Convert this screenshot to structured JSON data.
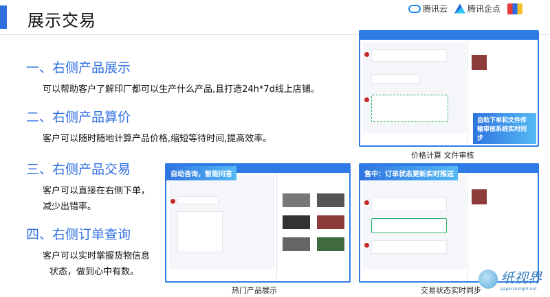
{
  "header": {
    "title": "展示交易",
    "logos": [
      "腾讯云",
      "腾讯企点"
    ]
  },
  "sections": [
    {
      "heading": "一、右侧产品展示",
      "lines": [
        "可以帮助客户了解印厂都可以生产什么产品,且打造24h*7d线上店铺。"
      ]
    },
    {
      "heading": "二、右侧产品算价",
      "lines": [
        "客户可以随时随地计算产品价格,缩短等待时间,提高效率。"
      ]
    },
    {
      "heading": "三、右侧产品交易",
      "lines": [
        "客户可以直接在右侧下单，",
        "减少出错率。"
      ]
    },
    {
      "heading": "四、右侧订单查询",
      "lines": [
        "客户可以实时掌握货物信息",
        "状态，做到心中有数。"
      ]
    }
  ],
  "screens": [
    {
      "banner": "自助下单和文件传输审核系统实时同步",
      "caption": "价格计算 文件审核"
    },
    {
      "banner": "自动咨询，智能问答",
      "caption": "热门产品展示"
    },
    {
      "banner": "售中：订单状态更新实时推送",
      "caption": "交易状态实时同步"
    }
  ],
  "watermark": {
    "text": "纸视界",
    "url": "papersinsight.net"
  },
  "colors": {
    "accent": "#2f6fe0",
    "frame": "#2f7be6"
  }
}
